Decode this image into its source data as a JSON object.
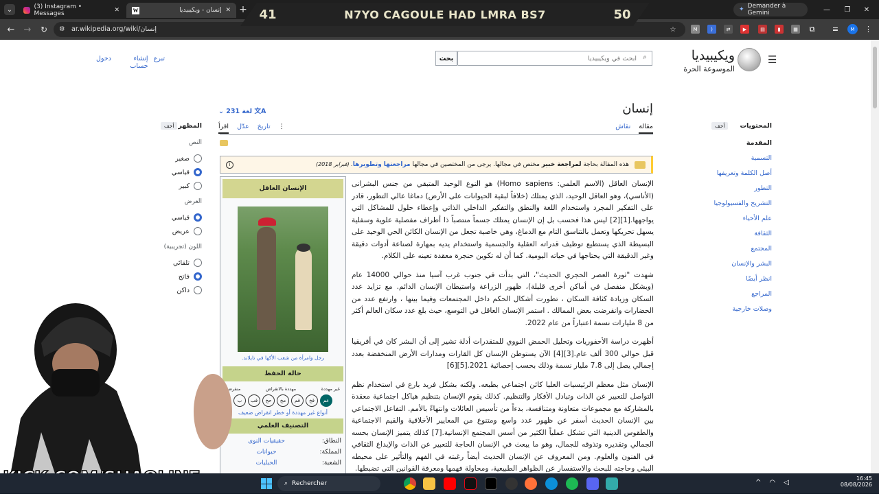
{
  "browser": {
    "tabs": [
      {
        "label": "(3) Instagram • Messages"
      },
      {
        "label": "إنسان - ويكيبيديا"
      }
    ],
    "gemini_label": "Demander à Gemini",
    "url": "ar.wikipedia.org/wiki/إنسان"
  },
  "overlay": {
    "score_left": "41",
    "title": "N7YO CAGOULE HAD LMRA BS7",
    "score_right": "50"
  },
  "wiki": {
    "logo_title": "ويكيبيديا",
    "logo_sub": "الموسوعة الحرة",
    "search_placeholder": "ابحث في ويكيبيديا",
    "search_button": "بحث",
    "user_links": [
      "تبرع",
      "إنشاء حساب",
      "دخول"
    ],
    "page_title": "إنسان",
    "languages": "231 لغة",
    "tabs": {
      "article": "مقالة",
      "talk": "نقاش",
      "read": "اقرأ",
      "edit": "عدّل",
      "history": "تاريخ"
    },
    "toc": {
      "title": "المحتويات",
      "hide": "أخف",
      "items": [
        "المقدمة",
        "التسمية",
        "أصل الكلمة وتعريفها",
        "التطور",
        "التشريح والفسيولوجيا",
        "علم الأحياء",
        "الثقافة",
        "المجتمع",
        "البشر والإنسان",
        "انظر أيضًا",
        "المراجع",
        "وصلات خارجية"
      ]
    },
    "appearance": {
      "title": "المظهر",
      "hide": "أخف",
      "text_label": "النص",
      "text_options": [
        "صغير",
        "قياسي",
        "كبير"
      ],
      "width_label": "العرض",
      "width_options": [
        "قياسي",
        "عريض"
      ],
      "color_label": "اللون (تجريبية)",
      "color_options": [
        "تلقائي",
        "فاتح",
        "داكن"
      ]
    },
    "notice": {
      "text_a": "هذه المقالة بحاجة ",
      "text_b": "لمراجعة خبير",
      "text_c": " مختص في مجالها. يرجى من المختصين في مجالها ",
      "text_d": "مراجعتها وتطويرها",
      "date": ". (فبراير 2018)"
    },
    "paragraphs": [
      "الإنسان العاقل (الاسم العلمي: Homo sapiens) هو النوع الوحيد المتبقي من جنس البشرانى (الأناسي)، وهو العاقل الوحيد، الذي يمتلك (خلافاً لبقية الحيوانات على الأرض) دماغا عالي التطور، قادر على التفكير المجرد واستخدام اللغة والنطق والتفكير الداخلي الذاتي وإعطاء حلول للمشاكل التي يواجهها.[1][2] ليس هذا فحسب بل إن الإنسان يمتلك جسماً منتصباً ذا أطراف مفصلية علوية وسفلية يسهل تحريكها وتعمل بالتناسق التام مع الدماغ، وهي خاصية تجعل من الإنسان الكائن الحي الوحيد على البسيطة الذي يستطيع توظيف قدراته العقلية والجسمية واستخدام يديه بمهارة لصناعة أدوات دقيقة وغير الدقيقة التي يحتاجها في حياته اليومية. كما أن له تكوين حنجرة معقدة تعينه على الكلام.",
      "شهدت \"ثورة العصر الحجري الحديث\"، التي بدأت في جنوب غرب آسيا منذ حوالي 14000 عام (وبشكل منفصل في أماكن أخرى قليلة)، ظهور الزراعة واستيطان الإنسان الدائم. مع تزايد عدد السكان وزيادة كثافة السكان ، تطورت أشكال الحكم داخل المجتمعات وفيما بينها ، وارتفع عدد من الحضارات وانقرضت بعض الممالك . استمر الإنسان العاقل في التوسع، حيث بلغ عدد سكان العالم أكثر من 8 مليارات نسمة اعتباراً من عام 2022.",
      "أظهرت دراسة الأحفوريات وتحليل الحمض النووي للمتقدرات أدلة تشير إلى أن البشر كان في أفريقيا قبل حوالي 300 ألف عام.[3][4] الآن يستوطن الإنسان كل القارات ومدارات الأرض المنخفضة بعدد إجمالي يصل إلى 7.8 مليار نسمة وذلك بحسب إحصائية 2021.[5][6]",
      "الإنسان مثل معظم الرئيسيات العليا كائن اجتماعي بطبعه. ولكنه بشكل فريد بارع في استخدام نظم التواصل للتعبير عن الذات وتبادل الأفكار والتنظيم. كذلك يقوم الإنسان بتنظيم هياكل اجتماعية معقدة بالمشاركة مع مجموعات متعاونة ومتنافسة، بدءاً من تأسيس العائلات وانتهاءً بالأمم. التفاعل الاجتماعي بين الإنسان الحديث أسفر عن ظهور عدد واسع ومتنوع من المعايير الأخلاقية والقيم الاجتماعية والطقوس الدينية التي تشكل عملياً الكثير من أسس المجتمع الإنسانية.[7] كذلك يتميز الإنسان بحسه الجمالي وتقديره وتذوقه للجمال، وهو ما يبعث في الإنسان الحاجة للتعبير عن الذات والإبداع الثقافي في الفنون والعلوم. ومن المعروف عن الإنسان الحديث أيضاً رغبته في الفهم والتأثير على محيطه البيئي وحاجته للبحث والاستفسار عن الظواهر الطبيعية، ومحاولة فهمها ومعرفة القوانين التي تضبطها."
    ],
    "infobox": {
      "title": "الإنسان العاقل",
      "caption": "رجل وامرأة من شعب الأكها في تايلاند.",
      "status_header": "حالة الحفظ",
      "status_labels": [
        "غير مهددة",
        "مهددة بالانقراض",
        "منقرضة"
      ],
      "status_codes": [
        "عم",
        "قخ",
        "قم",
        "مخ",
        "حخ",
        "قب",
        "ب"
      ],
      "status_link": "أنواع غير مهددة أو خطر انقراض ضعيف",
      "taxonomy_header": "التصنيف العلمي",
      "rows": [
        {
          "k": "النطاق:",
          "v": "حقيقيات النوى"
        },
        {
          "k": "المملكة:",
          "v": "حيوانات"
        },
        {
          "k": "الشعبة:",
          "v": "الحبليات"
        }
      ]
    }
  },
  "stream": {
    "brand": "KICK.COM/SHAOLINE"
  },
  "taskbar": {
    "search": "Rechercher",
    "time": "16:45",
    "date": "08/08/2026"
  }
}
